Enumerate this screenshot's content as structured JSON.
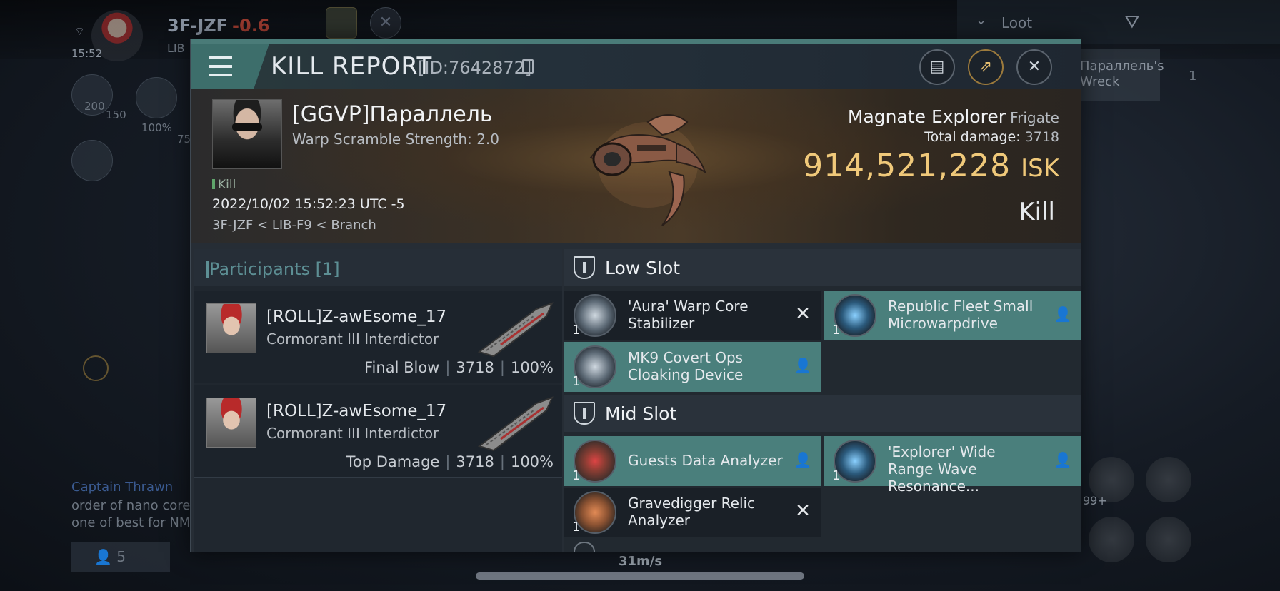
{
  "hud": {
    "system": "3F-JZF",
    "security": "-0.6",
    "sub": "LIB",
    "time": "15:52",
    "loot_label": "Loot",
    "wreck_label": "Параллель's Wreck",
    "wreck_count": "1",
    "nums": [
      "200",
      "150",
      "100%",
      "75"
    ],
    "chat_name": "Captain Thrawn",
    "chat_lines": [
      "order of nano core",
      "one of best for NM"
    ],
    "people_count": "5",
    "speed": "31m/s",
    "module_count": "99+"
  },
  "report": {
    "title": "KILL REPORT",
    "id": "[ID:7642872]",
    "victim": {
      "name": "[GGVP]Параллель",
      "warp": "Warp Scramble Strength: 2.0",
      "tag": "Kill",
      "date": "2022/10/02 15:52:23 UTC -5",
      "location": "3F-JZF < LIB-F9 < Branch"
    },
    "ship": {
      "name": "Magnate Explorer",
      "class": "Frigate",
      "total_damage_label": "Total damage:",
      "total_damage": "3718",
      "isk_value": "914,521,228",
      "isk_unit": "ISK",
      "result": "Kill"
    },
    "participants": {
      "title": "Participants [1]",
      "rows": [
        {
          "name": "[ROLL]Z-awEsome_17",
          "ship": "Cormorant III Interdictor",
          "role": "Final Blow",
          "damage": "3718",
          "percent": "100%"
        },
        {
          "name": "[ROLL]Z-awEsome_17",
          "ship": "Cormorant III Interdictor",
          "role": "Top Damage",
          "damage": "3718",
          "percent": "100%"
        }
      ]
    },
    "slots": {
      "low": {
        "label": "Low Slot",
        "items": [
          {
            "name": "'Aura' Warp Core Stabilizer",
            "qty": "1",
            "status": "destroyed",
            "icon": "warp-core-stabilizer-icon"
          },
          {
            "name": "Republic Fleet Small Microwarpdrive",
            "qty": "1",
            "status": "dropped",
            "icon": "microwarpdrive-icon"
          },
          {
            "name": "MK9 Covert Ops Cloaking Device",
            "qty": "1",
            "status": "dropped",
            "icon": "cloaking-device-icon"
          }
        ]
      },
      "mid": {
        "label": "Mid Slot",
        "items": [
          {
            "name": "Guests Data Analyzer",
            "qty": "1",
            "status": "dropped",
            "icon": "data-analyzer-icon"
          },
          {
            "name": "'Explorer' Wide Range Wave Resonance...",
            "qty": "1",
            "status": "dropped",
            "icon": "wave-resonance-icon"
          },
          {
            "name": "Gravedigger Relic Analyzer",
            "qty": "1",
            "status": "destroyed",
            "icon": "relic-analyzer-icon"
          }
        ]
      }
    }
  },
  "colors": {
    "accent_teal": "#4a7b78",
    "dropped_bg": "#4a7f7c",
    "isk_gold": "#f0c97a",
    "participants_title": "#5d8f94"
  }
}
